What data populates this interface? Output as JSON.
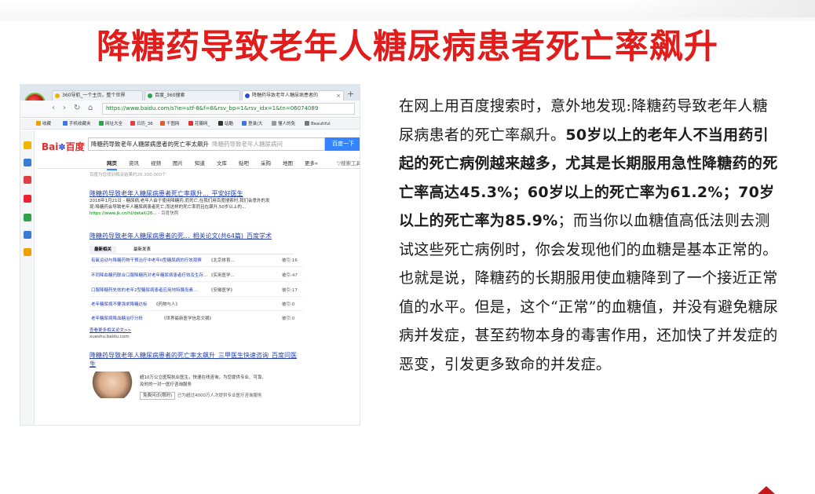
{
  "slide": {
    "title": "降糖药导致老年人糖尿病患者死亡率飙升",
    "colors": {
      "title": "#e21b1b",
      "accent": "#c51818"
    }
  },
  "browser": {
    "tabs": [
      {
        "label": "360导航_一个主页，整个世界",
        "icon": "360-icon"
      },
      {
        "label": "百度_360搜索",
        "icon": "360-search-icon"
      },
      {
        "label": "降糖药导致老年人糖尿病患者的",
        "icon": "baidu-paw-icon"
      }
    ],
    "url": "https://www.baidu.com/s?ie=utf-8&f=8&rsv_bp=1&rsv_idx=1&tn=06074089",
    "bookmarks": [
      {
        "label": "收藏",
        "color": "#f0a000"
      },
      {
        "label": "手机收藏夹",
        "color": "#3a7bd5"
      },
      {
        "label": "网址大全",
        "color": "#2fa24a"
      },
      {
        "label": "日历_36",
        "color": "#e04040"
      },
      {
        "label": "千图网",
        "color": "#e05a2a"
      },
      {
        "label": "花瓣网_",
        "color": "#d33"
      },
      {
        "label": "站酷",
        "color": "#333"
      },
      {
        "label": "登录|大",
        "color": "#3a7bd5"
      },
      {
        "label": "懂人的免",
        "color": "#999"
      },
      {
        "label": "Beautiful",
        "color": "#777"
      }
    ]
  },
  "baidu": {
    "logo_text": "Bai",
    "logo_text2": "百度",
    "query": "降糖药导致老年人糖尿病患者的死亡率太飙升",
    "ghost": "降糖药导致老年人糖尿病问",
    "search_button": "百度一下",
    "nav_tabs": [
      "网页",
      "资讯",
      "视频",
      "图片",
      "知道",
      "文库",
      "贴吧",
      "采购",
      "地图",
      "更多»"
    ],
    "search_tools": "▽搜索工具",
    "count": "百度为您找到相关结果约26,300,000个",
    "result1": {
      "title": "降糖药导致老年人糖尿病患者死亡率飙升..._平安好医生",
      "snip1": "2018年1月21日 - 糖尿病,老年人由于使用降糖药,而死亡,在我们用百度搜索时,我们会意外的发",
      "snip2": "现:降糖药会导致老年人糖尿病患者死亡,而这样的死亡率而且在飙升,50岁以上的...",
      "url": "https://www.jk.cn/hl/detail/26...",
      "cache": " - 百度快照"
    },
    "result2": {
      "title": "降糖药导致老年人糖尿病患者的死..._相关论文(共64篇)_百度学术"
    },
    "scholar_tabs": [
      "最新相关",
      "最新发表"
    ],
    "scholar_rows": [
      {
        "title": "有氧运动与降糖药物干预治疗中老年II型糖尿病的疗效观察",
        "journal": "《北京体育...",
        "cite": "被引:16"
      },
      {
        "title": "不同降血糖药联合口服降糖药对老年糖尿病患者疗效及生存...",
        "journal": "《实用医学...",
        "cite": "被引:47"
      },
      {
        "title": "口服降糖药失效的老年2型糖尿病患者应用地特胰岛素...",
        "journal": "《安徽医学》",
        "cite": "被引:17"
      },
      {
        "title": "老年糖尿病不要强求降糖达标",
        "journal": "《药物与人》",
        "cite": "被引:0"
      },
      {
        "title": "老年糖尿病降血糖治疗分析",
        "journal": "《世界最新医学信息文摘》",
        "cite": "被引:0"
      }
    ],
    "more_papers": "查看更多相关论文>>",
    "scholar_domain": "xueshu.baidu.com",
    "result3": {
      "title": "降糖药导致老年人糖尿病患者的死亡率太飙升_三甲医生快速咨询_百度问医",
      "title2": "生",
      "ad1": "超10万公立医院执业医生，快速在线咨询，为您提供专业、可靠、",
      "ad2": "及时的一对一医疗咨询服务",
      "button": "免费问诊(限时)",
      "button2": "已为超过4000万人次提供专业医疗咨询服务"
    }
  },
  "article": {
    "p1": "在网上用百度搜索时，意外地发现:降糖药导致老年人糖尿病患者的死亡率飙升。",
    "bold": "50岁以上的老年人不当用药引起的死亡病例越来越多，尤其是长期服用急性降糖药的死亡率高达45.3%；60岁以上的死亡率为61.2%；70岁以上的死亡率为85.9%",
    "p2": "；而当你以血糖值高低法则去测试这些死亡病例时，你会发现他们的血糖是基本正常的。也就是说，降糖药的长期服用使血糖降到了一个接近正常值的水平。但是，这个“正常”的血糖值，并没有避免糖尿病并发症，甚至药物本身的毒害作用，还加快了并发症的恶变，引发更多致命的并发症。"
  }
}
